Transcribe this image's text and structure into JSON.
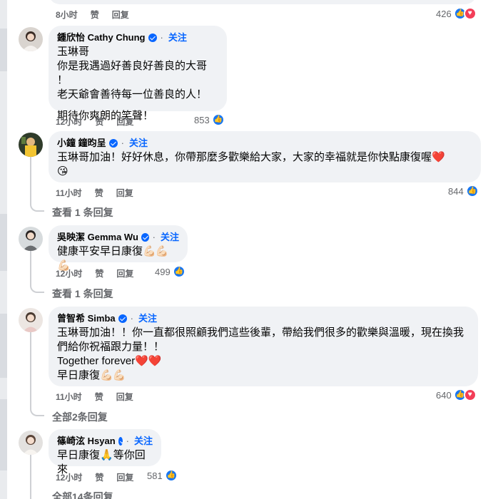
{
  "top_meta": {
    "time": "8小时",
    "like": "赞",
    "reply": "回复",
    "count": "426"
  },
  "comments": [
    {
      "name": "鍾欣怡 Cathy Chung",
      "follow": "关注",
      "lines": [
        "玉琳哥",
        "你是我遇過好善良好善良的大哥 ！",
        "老天爺會善待每一位善良的人！",
        "期待你爽朗的笑聲！"
      ],
      "time": "12小时",
      "like": "赞",
      "reply": "回复",
      "count": "853"
    },
    {
      "name": "小鐘 鐘昀呈",
      "follow": "关注",
      "line1": "玉琳哥加油！好好休息，你帶那麼多歡樂給大家，大家的幸福就是你快點康復喔",
      "heart": "❤️",
      "line2": "😘",
      "time": "11小时",
      "like": "赞",
      "reply": "回复",
      "count": "844",
      "replies": "查看 1 条回复"
    },
    {
      "name": "吳映潔 Gemma Wu",
      "follow": "关注",
      "line1": "健康平安早日康復",
      "muscles": "💪🏻💪🏻💪🏻",
      "time": "12小时",
      "like": "赞",
      "reply": "回复",
      "count": "499",
      "replies": "查看 1 条回复"
    },
    {
      "name": "曾智希 Simba",
      "follow": "关注",
      "line1": "玉琳哥加油！！你一直都很照顧我們這些後輩，帶給我們很多的歡樂與溫暖，現在換我",
      "line2": "們給你祝福跟力量！！",
      "line3": "Together forever",
      "hearts": "❤️❤️",
      "line4": "早日康復",
      "muscles": "💪🏻💪🏻",
      "time": "11小时",
      "like": "赞",
      "reply": "回复",
      "count": "640",
      "replies": "全部2条回复"
    },
    {
      "name": "篠崎泫 Hsyan",
      "follow": "关注",
      "line1a": "早日康復",
      "pray": "🙏",
      "line1b": "等你回來",
      "time": "12小时",
      "like": "赞",
      "reply": "回复",
      "count": "581",
      "replies": "全部14条回复"
    }
  ],
  "colors": {
    "link": "#0866ff",
    "like": "#1877f2",
    "love": "#f33e58",
    "bubble": "#f0f2f5",
    "meta": "#65676b"
  }
}
